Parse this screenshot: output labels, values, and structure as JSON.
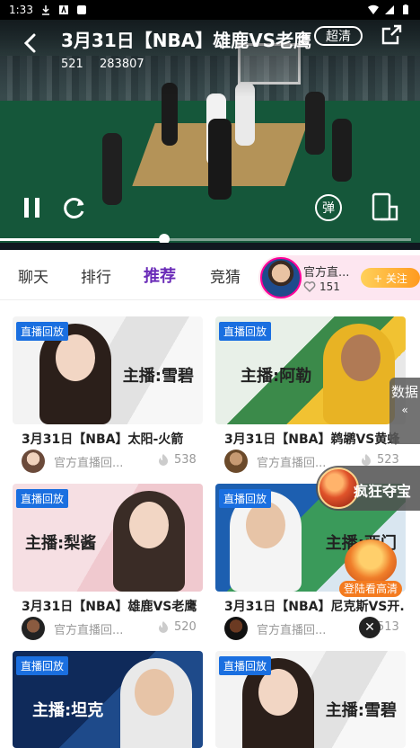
{
  "status_bar": {
    "time": "1:33"
  },
  "player": {
    "title": "3月31日【NBA】雄鹿VS老鹰",
    "stat_a": "521",
    "stat_b": "283807",
    "hd_label": "超清",
    "danmaku_label": "弹",
    "progress": 0.4
  },
  "tabs": [
    {
      "label": "聊天"
    },
    {
      "label": "排行"
    },
    {
      "label": "推荐",
      "active": true
    },
    {
      "label": "竞猜"
    }
  ],
  "anchor": {
    "name": "官方直...",
    "likes": "151",
    "follow_label": "+ 关注"
  },
  "cards": [
    {
      "badge": "直播回放",
      "host": "主播:雪碧",
      "title": "3月31日【NBA】太阳-火箭",
      "channel": "官方直播回...",
      "views": "538"
    },
    {
      "badge": "直播回放",
      "host": "主播:阿勒",
      "title": "3月31日【NBA】鹈鹕VS黄蜂",
      "channel": "官方直播回...",
      "views": "523"
    },
    {
      "badge": "直播回放",
      "host": "主播:梨酱",
      "title": "3月31日【NBA】雄鹿VS老鹰",
      "channel": "官方直播回...",
      "views": "520"
    },
    {
      "badge": "直播回放",
      "host": "主播:西门",
      "title": "3月31日【NBA】尼克斯VS开...",
      "channel": "官方直播回...",
      "views": "513"
    },
    {
      "badge": "直播回放",
      "host": "主播:坦克",
      "title": "",
      "channel": "",
      "views": ""
    },
    {
      "badge": "直播回放",
      "host": "主播:雪碧",
      "title": "",
      "channel": "",
      "views": ""
    }
  ],
  "floating": {
    "data_tab": "数据",
    "data_arrow": "«",
    "treasure": "疯狂夺宝",
    "gift_label": "登陆看高清",
    "close": "✕"
  },
  "colors": {
    "accent": "#6a2bb8",
    "badge": "#1a6fe0",
    "follow": "#ff9a1f"
  }
}
